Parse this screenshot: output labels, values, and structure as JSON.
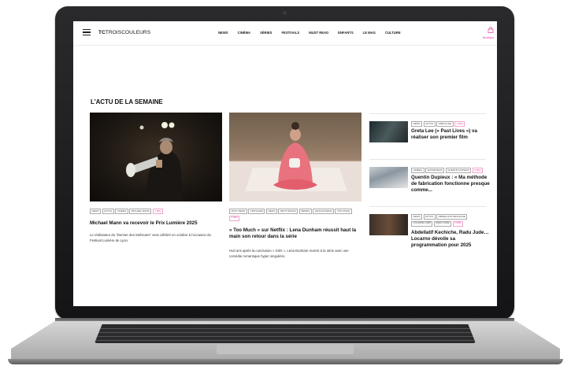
{
  "site": {
    "logo_bold": "TC",
    "logo_rest": "TROISCOULEURS",
    "nav": [
      "NEWS",
      "CINÉMA",
      "SÉRIES",
      "FESTIVALS",
      "MUST READ",
      "ENFANTS",
      "LE MAG",
      "CULTURE"
    ],
    "subscribe_label": "Boutique"
  },
  "section": {
    "title": "L'ACTU DE LA SEMAINE"
  },
  "featured": [
    {
      "tags": [
        "NEWS",
        "ACTUS",
        "CINÉMA",
        "MICHAEL MANN"
      ],
      "pink_tag": "1 MIN",
      "headline": "Michael Mann va recevoir le Prix Lumière 2025",
      "excerpt": "Le réalisateur du \"Dernier des Mohicans\" sera célébré en octobre à l'occasion du Festival Lumière de Lyon."
    },
    {
      "tags": [
        "MUST READ",
        "CRITIQUES",
        "NEWS",
        "PETIT ÉCRAN",
        "SÉRIES",
        "LENA DUNHAM",
        "TOO MUCH"
      ],
      "pink_tag": "2 MIN",
      "headline": "« Too Much » sur Netflix : Lena Dunham réussit haut la main son retour dans la série",
      "excerpt": "Huit ans après la conclusion « Girls », Lena Dunham revient à la série avec une comédie romantique hyper singulière."
    }
  ],
  "side": [
    {
      "tags": [
        "NEWS",
        "ACTUS",
        "GRETA LEE"
      ],
      "pink_tag": "1 MIN",
      "headline": "Greta Lee (« Past Lives ») va réaliser son premier film"
    },
    {
      "tags": [
        "CINÉMA",
        "ENTRETIENS",
        "QUENTIN DUPIEUX"
      ],
      "pink_tag": "6 MIN",
      "headline": "Quentin Dupieux : « Ma méthode de fabrication fonctionne presque comme..."
    },
    {
      "tags": [
        "NEWS",
        "ACTUS",
        "ABDELLATIF KECHICHE",
        "LOCARNO 2025",
        "RADU JUDE"
      ],
      "pink_tag": "1 MIN",
      "headline": "Abdellatif Kechiche, Radu Jude… Locarno dévoile sa programmation pour 2025"
    }
  ]
}
